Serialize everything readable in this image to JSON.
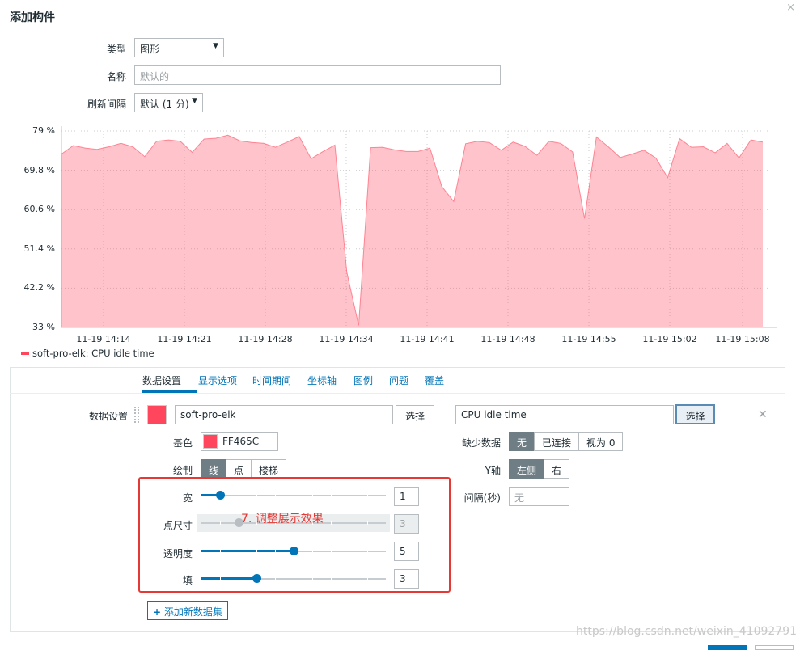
{
  "dialog": {
    "title": "添加构件",
    "close": "×"
  },
  "form": {
    "type_label": "类型",
    "type_value": "图形",
    "name_label": "名称",
    "name_placeholder": "默认的",
    "refresh_label": "刷新间隔",
    "refresh_value": "默认 (1 分)"
  },
  "chart_data": {
    "type": "area",
    "y_ticks": [
      "79 %",
      "69.8 %",
      "60.6 %",
      "51.4 %",
      "42.2 %",
      "33 %"
    ],
    "ylim": [
      33,
      79
    ],
    "x_ticks": [
      "11-19 14:14",
      "11-19 14:21",
      "11-19 14:28",
      "11-19 14:34",
      "11-19 14:41",
      "11-19 14:48",
      "11-19 14:55",
      "11-19 15:02",
      "11-19 15:08"
    ],
    "series": [
      {
        "name": "soft-pro-elk: CPU idle time",
        "color": "#ff465c",
        "values": [
          73.6,
          75.6,
          75,
          74.7,
          75.3,
          76.1,
          75.3,
          73,
          76.6,
          76.9,
          76.6,
          74,
          77.1,
          77.3,
          78,
          76.7,
          76.3,
          76.1,
          75.2,
          76.4,
          77.7,
          72.5,
          74.2,
          75.7,
          46,
          33.5,
          75.1,
          75.2,
          74.6,
          74.2,
          74.2,
          75,
          66,
          62.5,
          76,
          76.6,
          76.3,
          74.5,
          76.4,
          75.4,
          73.3,
          76.6,
          76.1,
          74.1,
          58.5,
          77.6,
          75.3,
          72.8,
          73.6,
          74.5,
          72.7,
          68.1,
          77.2,
          75.2,
          75.3,
          73.9,
          76.1,
          72.7,
          76.9,
          76.4
        ]
      }
    ],
    "legend": "soft-pro-elk: CPU idle time",
    "grid": true
  },
  "tabs": [
    "数据设置",
    "显示选项",
    "时间期间",
    "坐标轴",
    "图例",
    "问题",
    "覆盖"
  ],
  "dataset": {
    "label": "数据设置",
    "host": "soft-pro-elk",
    "host_select": "选择",
    "item": "CPU idle time",
    "item_select": "选择",
    "color_label": "基色",
    "color_value": "FF465C",
    "color_hex": "#ff465c",
    "draw_label": "绘制",
    "draw_options": [
      "线",
      "点",
      "楼梯"
    ],
    "draw_selected": "线",
    "width_label": "宽",
    "width_value": "1",
    "width_fraction": 0.1,
    "point_label": "点尺寸",
    "point_value": "3",
    "point_fraction": 0.2,
    "transparency_label": "透明度",
    "transparency_value": "5",
    "transparency_fraction": 0.5,
    "fill_label": "填",
    "fill_value": "3",
    "fill_fraction": 0.3,
    "missing_label": "缺少数据",
    "missing_options": [
      "无",
      "已连接",
      "视为 0"
    ],
    "missing_selected": "无",
    "yaxis_label": "Y轴",
    "yaxis_options": [
      "左侧",
      "右"
    ],
    "yaxis_selected": "左侧",
    "interval_label": "间隔(秒)",
    "interval_placeholder": "无"
  },
  "annotation": "7. 调整展示效果",
  "add_dataset": "添加新数据集",
  "watermark": "https://blog.csdn.net/weixin_41092791"
}
